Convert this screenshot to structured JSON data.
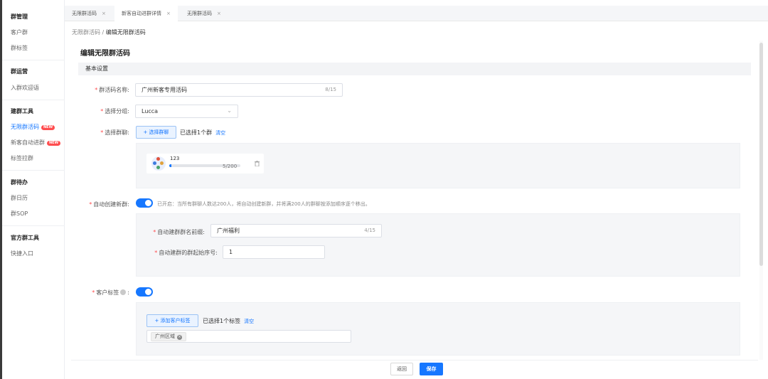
{
  "sidebar": {
    "groups": [
      {
        "title": "群管理",
        "items": [
          "客户群",
          "群标签"
        ]
      },
      {
        "title": "群运营",
        "items": [
          "入群欢迎语"
        ]
      },
      {
        "title": "建群工具",
        "items": [
          "无限群活码",
          "新客自动进群",
          "标签拉群"
        ]
      },
      {
        "title": "群待办",
        "items": [
          "群日历",
          "群SOP"
        ]
      },
      {
        "title": "官方群工具",
        "items": [
          "快捷入口"
        ]
      }
    ],
    "new_badge": "NEW",
    "active_item": "无限群活码"
  },
  "tabs": [
    {
      "label": "无限群活码",
      "close": "×"
    },
    {
      "label": "新客自动进群详情",
      "close": "×"
    },
    {
      "label": "无限群活码",
      "close": "×"
    }
  ],
  "breadcrumb": {
    "parent": "无限群活码",
    "separator": "/",
    "current": "编辑无限群活码"
  },
  "page_title": "编辑无限群活码",
  "section_title": "基本设置",
  "form": {
    "name": {
      "label": "群活码名称:",
      "value": "广州新客专用活码",
      "count": "8/15"
    },
    "group": {
      "label": "选择分组:",
      "value": "Lucca"
    },
    "chat": {
      "label": "选择群聊:",
      "button": "+ 选择群聊",
      "selected_text": "已选择1个群",
      "clear": "清空",
      "card": {
        "name": "123",
        "count_text": "5/200",
        "progress": 0.025
      }
    },
    "auto_create": {
      "label": "自动创建新群:",
      "enabled": true,
      "hint": "已开启：当所有群聊人数达200人，将自动创建新群，并将满200人的群聊按添加顺序逐个移出。",
      "prefix": {
        "label": "自动建群群名前缀:",
        "value": "广州福利",
        "count": "4/15"
      },
      "start_no": {
        "label": "自动建群的群起始序号:",
        "value": "1"
      }
    },
    "tags": {
      "label": "客户标签",
      "colon": ":",
      "enabled": true,
      "button": "+ 添加客户标签",
      "selected_text": "已选择1个标签",
      "clear": "清空",
      "chip": "广州区域"
    }
  },
  "footer": {
    "back": "返回",
    "save": "保存"
  },
  "colors": {
    "accent": "#1677ff",
    "required": "#ff4d4f",
    "new_badge": "#ff4d4f"
  }
}
